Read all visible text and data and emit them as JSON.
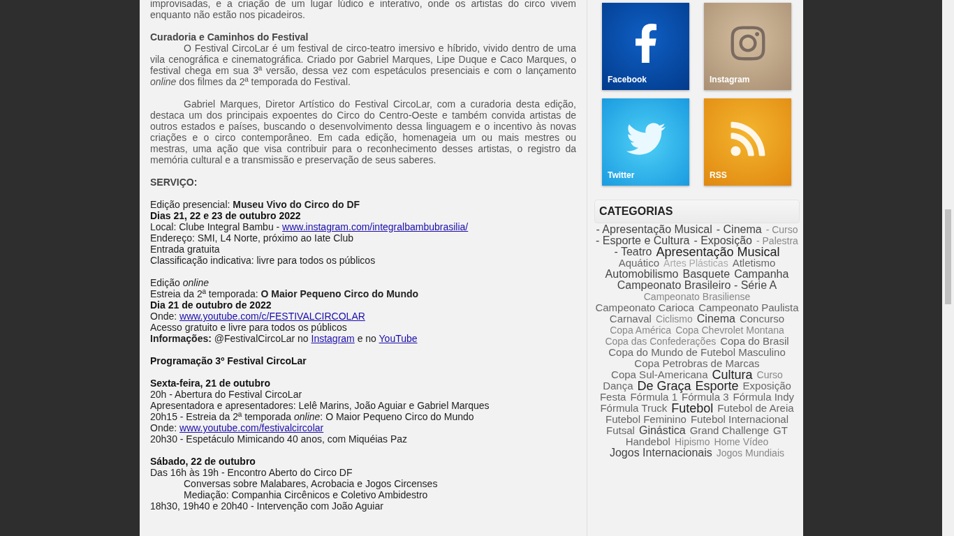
{
  "article": {
    "sections": [
      {
        "blocks": [
          {
            "kind": "paragraph",
            "indented": false,
            "text": "improvisadas, e a criação de um lugar lúdico e interativo, onde os artistas do circo vivem enquanto não estão nos picadeiros."
          }
        ]
      },
      {
        "blocks": [
          {
            "kind": "title",
            "text": "Curadoria e Caminhos do Festival"
          },
          {
            "kind": "paragraph",
            "indented": true,
            "text": "O Festival CircoLar é um festival de circo-teatro imersivo e híbrido, vivido dentro de uma vila cenográfica e cinematográfica. Criado por Gabriel Marques, Lipe Duque e Caco Marques, o festival chega em sua 3ª versão, dessa vez com espetáculos presenciais e com o lançamento *online* dos filmes da 2ª temporada do Festival."
          }
        ]
      },
      {
        "blocks": [
          {
            "kind": "paragraph",
            "indented": true,
            "text": "Gabriel Marques, Diretor Artístico do Festival CircoLar, com a curadoria desta edição, destaca um dos principais expoentes do Circo do Centro-Oeste e também convida artistas de outros estados e países, buscando o desenvolvimento dessa linguagem e o incentivo às novas criações e o circo contemporâneo. Em cada edição, homenageia um ou mais mestres ou mestras, uma ação que visa contribuir para o reconhecimento desses artistas, o registro da memória cultural e a transmissão e preservação de seus saberes."
          }
        ]
      },
      {
        "blocks": [
          {
            "kind": "title",
            "text": "SERVIÇO:"
          }
        ]
      },
      {
        "blocks": [
          {
            "kind": "line",
            "indented": false,
            "parts": [
              {
                "kind": "text",
                "text": "Edição presencial: **Museu Vivo do Circo do DF**"
              }
            ]
          },
          {
            "kind": "heading",
            "text": "Dias 21, 22 e 23 de outubro 2022"
          },
          {
            "kind": "line",
            "indented": false,
            "parts": [
              {
                "kind": "text",
                "text": "Local: Clube Integral Bambu - "
              },
              {
                "kind": "link",
                "text": "www.instagram.com/integralbambubrasilia/"
              }
            ]
          },
          {
            "kind": "line",
            "indented": false,
            "parts": [
              {
                "kind": "text",
                "text": "Endereço: SMI, L4 Norte, próximo ao Iate Club"
              }
            ]
          },
          {
            "kind": "line",
            "indented": false,
            "parts": [
              {
                "kind": "text",
                "text": "Entrada gratuita"
              }
            ]
          },
          {
            "kind": "line",
            "indented": false,
            "parts": [
              {
                "kind": "text",
                "text": "Classificação indicativa: livre para todos os públicos"
              }
            ]
          }
        ]
      },
      {
        "blocks": [
          {
            "kind": "line",
            "indented": false,
            "parts": [
              {
                "kind": "text",
                "text": "Edição *online*"
              }
            ]
          },
          {
            "kind": "line",
            "indented": false,
            "parts": [
              {
                "kind": "text",
                "text": "Estreia da 2ª temporada: **O Maior Pequeno Circo do Mundo**"
              }
            ]
          },
          {
            "kind": "heading",
            "text": "Dia 21 de outubro de 2022"
          },
          {
            "kind": "line",
            "indented": false,
            "parts": [
              {
                "kind": "text",
                "text": "Onde: "
              },
              {
                "kind": "link",
                "text": "www.youtube.com/c/FESTIVALCIRCOLAR"
              }
            ]
          },
          {
            "kind": "line",
            "indented": false,
            "parts": [
              {
                "kind": "text",
                "text": "Acesso gratuito e livre para todos os públicos"
              }
            ]
          },
          {
            "kind": "line",
            "indented": false,
            "parts": [
              {
                "kind": "text",
                "text": "**Informações:** @FestivalCircoLar no "
              },
              {
                "kind": "link",
                "text": "Instagram"
              },
              {
                "kind": "text",
                "text": " e no "
              },
              {
                "kind": "link",
                "text": "YouTube"
              }
            ]
          }
        ]
      },
      {
        "blocks": [
          {
            "kind": "heading",
            "text": "Programação 3º Festival CircoLar"
          }
        ]
      },
      {
        "blocks": [
          {
            "kind": "heading",
            "text": "Sexta-feira, 21 de outubro"
          },
          {
            "kind": "line",
            "indented": false,
            "parts": [
              {
                "kind": "text",
                "text": "20h - Abertura do Festival CircoLar"
              }
            ]
          },
          {
            "kind": "line",
            "indented": false,
            "parts": [
              {
                "kind": "text",
                "text": "Apresentadora e apresentadores: Lelê Marins, João Aguiar e Gabriel Marques"
              }
            ]
          },
          {
            "kind": "line",
            "indented": false,
            "parts": [
              {
                "kind": "text",
                "text": "20h15 - Estreia da 2ª temporada *online*: O Maior Pequeno Circo do Mundo"
              }
            ]
          },
          {
            "kind": "line",
            "indented": false,
            "parts": [
              {
                "kind": "text",
                "text": "Onde: "
              },
              {
                "kind": "link",
                "text": "www.youtube.com/festivalcircolar"
              }
            ]
          },
          {
            "kind": "line",
            "indented": false,
            "parts": [
              {
                "kind": "text",
                "text": "20h30 - Espetáculo Mimicando 40 anos, com Miquéias Paz"
              }
            ]
          }
        ]
      },
      {
        "blocks": [
          {
            "kind": "heading",
            "text": "Sábado, 22 de outubro"
          },
          {
            "kind": "line",
            "indented": false,
            "parts": [
              {
                "kind": "text",
                "text": "Das 16h às 19h - Encontro Aberto do Circo DF"
              }
            ]
          },
          {
            "kind": "line",
            "indented": true,
            "parts": [
              {
                "kind": "text",
                "text": "Conversas sobre Malabares, Acrobacia e Jogos Circenses"
              }
            ]
          },
          {
            "kind": "line",
            "indented": true,
            "parts": [
              {
                "kind": "text",
                "text": "Mediação: Companhia Circênicos e Coletivo Ambidestro"
              }
            ]
          },
          {
            "kind": "line",
            "indented": false,
            "parts": [
              {
                "kind": "text",
                "text": "18h30, 19h40 e 20h40 - Intervenção com João Aguiar"
              }
            ]
          }
        ]
      }
    ]
  },
  "social": [
    {
      "kind": "facebook",
      "label": "Facebook"
    },
    {
      "kind": "instagram",
      "label": "Instagram"
    },
    {
      "kind": "twitter",
      "label": "Twitter"
    },
    {
      "kind": "rss",
      "label": "RSS"
    }
  ],
  "categories": {
    "title": "CATEGORIAS",
    "tags": [
      {
        "text": "- Apresentação Musical",
        "kind": "large"
      },
      {
        "text": "- Cinema",
        "kind": "large"
      },
      {
        "text": "- Curso",
        "kind": "small"
      },
      {
        "text": "- Esporte e Cultura",
        "kind": "large"
      },
      {
        "text": "- Exposição",
        "kind": "large"
      },
      {
        "text": "- Palestra",
        "kind": "small"
      },
      {
        "text": "- Teatro",
        "kind": "large"
      },
      {
        "text": "Apresentação Musical",
        "kind": "xlarge"
      },
      {
        "text": "Aquático",
        "kind": "medium"
      },
      {
        "text": "Artes Plásticas",
        "kind": "tiny"
      },
      {
        "text": "Atletismo",
        "kind": "medium"
      },
      {
        "text": "Automobilismo",
        "kind": "large"
      },
      {
        "text": "Basquete",
        "kind": "large"
      },
      {
        "text": "Campanha",
        "kind": "large"
      },
      {
        "text": "Campeonato Brasileiro - Série A",
        "kind": "large"
      },
      {
        "text": "Campeonato Brasiliense",
        "kind": "small"
      },
      {
        "text": "Campeonato Carioca",
        "kind": "medium"
      },
      {
        "text": "Campeonato Paulista",
        "kind": "medium"
      },
      {
        "text": "Carnaval",
        "kind": "medium"
      },
      {
        "text": "Ciclismo",
        "kind": "small"
      },
      {
        "text": "Cinema",
        "kind": "large"
      },
      {
        "text": "Concurso",
        "kind": "medium"
      },
      {
        "text": "Copa América",
        "kind": "small"
      },
      {
        "text": "Copa Chevrolet Montana",
        "kind": "small"
      },
      {
        "text": "Copa das Confederações",
        "kind": "small"
      },
      {
        "text": "Copa do Brasil",
        "kind": "medium"
      },
      {
        "text": "Copa do Mundo de Futebol Masculino",
        "kind": "medium"
      },
      {
        "text": "Copa Petrobras de Marcas",
        "kind": "medium"
      },
      {
        "text": "Copa Sul-Americana",
        "kind": "medium"
      },
      {
        "text": "Cultura",
        "kind": "xlarge"
      },
      {
        "text": "Curso",
        "kind": "small"
      },
      {
        "text": "Dança",
        "kind": "medium"
      },
      {
        "text": "De Graça",
        "kind": "xlarge"
      },
      {
        "text": "Esporte",
        "kind": "xlarge"
      },
      {
        "text": "Exposição",
        "kind": "medium"
      },
      {
        "text": "Festa",
        "kind": "medium"
      },
      {
        "text": "Fórmula 1",
        "kind": "medium"
      },
      {
        "text": "Fórmula 3",
        "kind": "medium"
      },
      {
        "text": "Fórmula Indy",
        "kind": "medium"
      },
      {
        "text": "Fórmula Truck",
        "kind": "medium"
      },
      {
        "text": "Futebol",
        "kind": "xlarge"
      },
      {
        "text": "Futebol de Areia",
        "kind": "medium"
      },
      {
        "text": "Futebol Feminino",
        "kind": "medium"
      },
      {
        "text": "Futebol Internacional",
        "kind": "medium"
      },
      {
        "text": "Futsal",
        "kind": "medium"
      },
      {
        "text": "Ginástica",
        "kind": "large"
      },
      {
        "text": "Grand Challenge",
        "kind": "medium"
      },
      {
        "text": "GT",
        "kind": "medium"
      },
      {
        "text": "Handebol",
        "kind": "medium"
      },
      {
        "text": "Hipismo",
        "kind": "small"
      },
      {
        "text": "Home Vídeo",
        "kind": "small"
      },
      {
        "text": "Jogos Internacionais",
        "kind": "large"
      },
      {
        "text": "Jogos Mundiais",
        "kind": "small"
      }
    ]
  }
}
